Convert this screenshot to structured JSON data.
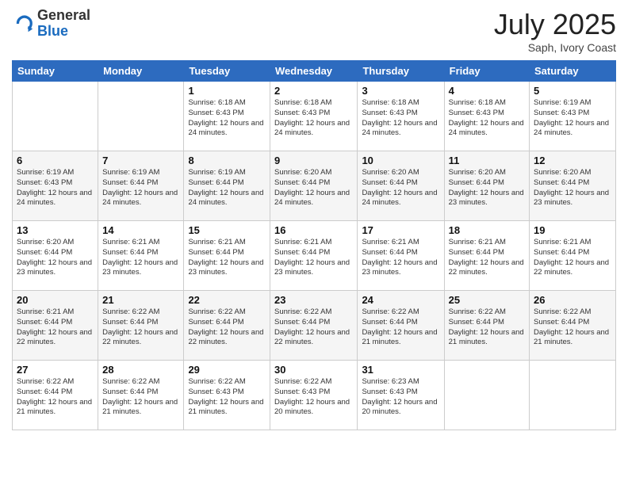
{
  "header": {
    "logo_general": "General",
    "logo_blue": "Blue",
    "month_title": "July 2025",
    "location": "Saph, Ivory Coast"
  },
  "days_of_week": [
    "Sunday",
    "Monday",
    "Tuesday",
    "Wednesday",
    "Thursday",
    "Friday",
    "Saturday"
  ],
  "weeks": [
    [
      {
        "num": "",
        "info": ""
      },
      {
        "num": "",
        "info": ""
      },
      {
        "num": "1",
        "info": "Sunrise: 6:18 AM\nSunset: 6:43 PM\nDaylight: 12 hours and 24 minutes."
      },
      {
        "num": "2",
        "info": "Sunrise: 6:18 AM\nSunset: 6:43 PM\nDaylight: 12 hours and 24 minutes."
      },
      {
        "num": "3",
        "info": "Sunrise: 6:18 AM\nSunset: 6:43 PM\nDaylight: 12 hours and 24 minutes."
      },
      {
        "num": "4",
        "info": "Sunrise: 6:18 AM\nSunset: 6:43 PM\nDaylight: 12 hours and 24 minutes."
      },
      {
        "num": "5",
        "info": "Sunrise: 6:19 AM\nSunset: 6:43 PM\nDaylight: 12 hours and 24 minutes."
      }
    ],
    [
      {
        "num": "6",
        "info": "Sunrise: 6:19 AM\nSunset: 6:43 PM\nDaylight: 12 hours and 24 minutes."
      },
      {
        "num": "7",
        "info": "Sunrise: 6:19 AM\nSunset: 6:44 PM\nDaylight: 12 hours and 24 minutes."
      },
      {
        "num": "8",
        "info": "Sunrise: 6:19 AM\nSunset: 6:44 PM\nDaylight: 12 hours and 24 minutes."
      },
      {
        "num": "9",
        "info": "Sunrise: 6:20 AM\nSunset: 6:44 PM\nDaylight: 12 hours and 24 minutes."
      },
      {
        "num": "10",
        "info": "Sunrise: 6:20 AM\nSunset: 6:44 PM\nDaylight: 12 hours and 24 minutes."
      },
      {
        "num": "11",
        "info": "Sunrise: 6:20 AM\nSunset: 6:44 PM\nDaylight: 12 hours and 23 minutes."
      },
      {
        "num": "12",
        "info": "Sunrise: 6:20 AM\nSunset: 6:44 PM\nDaylight: 12 hours and 23 minutes."
      }
    ],
    [
      {
        "num": "13",
        "info": "Sunrise: 6:20 AM\nSunset: 6:44 PM\nDaylight: 12 hours and 23 minutes."
      },
      {
        "num": "14",
        "info": "Sunrise: 6:21 AM\nSunset: 6:44 PM\nDaylight: 12 hours and 23 minutes."
      },
      {
        "num": "15",
        "info": "Sunrise: 6:21 AM\nSunset: 6:44 PM\nDaylight: 12 hours and 23 minutes."
      },
      {
        "num": "16",
        "info": "Sunrise: 6:21 AM\nSunset: 6:44 PM\nDaylight: 12 hours and 23 minutes."
      },
      {
        "num": "17",
        "info": "Sunrise: 6:21 AM\nSunset: 6:44 PM\nDaylight: 12 hours and 23 minutes."
      },
      {
        "num": "18",
        "info": "Sunrise: 6:21 AM\nSunset: 6:44 PM\nDaylight: 12 hours and 22 minutes."
      },
      {
        "num": "19",
        "info": "Sunrise: 6:21 AM\nSunset: 6:44 PM\nDaylight: 12 hours and 22 minutes."
      }
    ],
    [
      {
        "num": "20",
        "info": "Sunrise: 6:21 AM\nSunset: 6:44 PM\nDaylight: 12 hours and 22 minutes."
      },
      {
        "num": "21",
        "info": "Sunrise: 6:22 AM\nSunset: 6:44 PM\nDaylight: 12 hours and 22 minutes."
      },
      {
        "num": "22",
        "info": "Sunrise: 6:22 AM\nSunset: 6:44 PM\nDaylight: 12 hours and 22 minutes."
      },
      {
        "num": "23",
        "info": "Sunrise: 6:22 AM\nSunset: 6:44 PM\nDaylight: 12 hours and 22 minutes."
      },
      {
        "num": "24",
        "info": "Sunrise: 6:22 AM\nSunset: 6:44 PM\nDaylight: 12 hours and 21 minutes."
      },
      {
        "num": "25",
        "info": "Sunrise: 6:22 AM\nSunset: 6:44 PM\nDaylight: 12 hours and 21 minutes."
      },
      {
        "num": "26",
        "info": "Sunrise: 6:22 AM\nSunset: 6:44 PM\nDaylight: 12 hours and 21 minutes."
      }
    ],
    [
      {
        "num": "27",
        "info": "Sunrise: 6:22 AM\nSunset: 6:44 PM\nDaylight: 12 hours and 21 minutes."
      },
      {
        "num": "28",
        "info": "Sunrise: 6:22 AM\nSunset: 6:44 PM\nDaylight: 12 hours and 21 minutes."
      },
      {
        "num": "29",
        "info": "Sunrise: 6:22 AM\nSunset: 6:43 PM\nDaylight: 12 hours and 21 minutes."
      },
      {
        "num": "30",
        "info": "Sunrise: 6:22 AM\nSunset: 6:43 PM\nDaylight: 12 hours and 20 minutes."
      },
      {
        "num": "31",
        "info": "Sunrise: 6:23 AM\nSunset: 6:43 PM\nDaylight: 12 hours and 20 minutes."
      },
      {
        "num": "",
        "info": ""
      },
      {
        "num": "",
        "info": ""
      }
    ]
  ]
}
